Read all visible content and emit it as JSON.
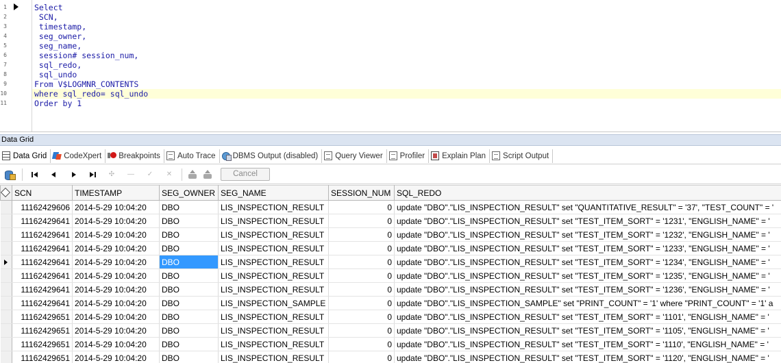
{
  "editor": {
    "line_numbers": [
      "1",
      "2",
      "3",
      "4",
      "5",
      "6",
      "7",
      "8",
      "9",
      "10",
      "11"
    ],
    "lines": [
      "Select",
      " SCN,",
      " timestamp,",
      " seg_owner,",
      " seg_name,",
      " session# session_num,",
      " sql_redo,",
      " sql_undo",
      "From V$LOGMNR_CONTENTS",
      "where sql_redo= sql_undo",
      "Order by 1"
    ],
    "highlight_line": 10
  },
  "panel": {
    "title": "Data Grid"
  },
  "tabs": [
    {
      "label": "Data Grid",
      "icon": "grid-icon",
      "active": true
    },
    {
      "label": "CodeXpert",
      "icon": "codexpert-icon"
    },
    {
      "label": "Breakpoints",
      "icon": "breakpoint-icon"
    },
    {
      "label": "Auto Trace",
      "icon": "page-icon"
    },
    {
      "label": "DBMS Output (disabled)",
      "icon": "dbms-output-icon"
    },
    {
      "label": "Query Viewer",
      "icon": "page-icon"
    },
    {
      "label": "Profiler",
      "icon": "page-icon"
    },
    {
      "label": "Explain Plan",
      "icon": "explain-plan-icon"
    },
    {
      "label": "Script Output",
      "icon": "page-icon"
    }
  ],
  "toolbar": {
    "cancel_label": "Cancel"
  },
  "grid": {
    "columns": [
      "SCN",
      "TIMESTAMP",
      "SEG_OWNER",
      "SEG_NAME",
      "SESSION_NUM",
      "SQL_REDO"
    ],
    "current_row": 4,
    "selected_cell": [
      4,
      2
    ],
    "rows": [
      [
        "11162429606",
        "2014-5-29 10:04:20",
        "DBO",
        "LIS_INSPECTION_RESULT",
        "0",
        "update \"DBO\".\"LIS_INSPECTION_RESULT\" set \"QUANTITATIVE_RESULT\" = '37', \"TEST_COUNT\" = '"
      ],
      [
        "11162429641",
        "2014-5-29 10:04:20",
        "DBO",
        "LIS_INSPECTION_RESULT",
        "0",
        "update \"DBO\".\"LIS_INSPECTION_RESULT\" set \"TEST_ITEM_SORT\" = '1231', \"ENGLISH_NAME\" = '"
      ],
      [
        "11162429641",
        "2014-5-29 10:04:20",
        "DBO",
        "LIS_INSPECTION_RESULT",
        "0",
        "update \"DBO\".\"LIS_INSPECTION_RESULT\" set \"TEST_ITEM_SORT\" = '1232', \"ENGLISH_NAME\" = '"
      ],
      [
        "11162429641",
        "2014-5-29 10:04:20",
        "DBO",
        "LIS_INSPECTION_RESULT",
        "0",
        "update \"DBO\".\"LIS_INSPECTION_RESULT\" set \"TEST_ITEM_SORT\" = '1233', \"ENGLISH_NAME\" = '"
      ],
      [
        "11162429641",
        "2014-5-29 10:04:20",
        "DBO",
        "LIS_INSPECTION_RESULT",
        "0",
        "update \"DBO\".\"LIS_INSPECTION_RESULT\" set \"TEST_ITEM_SORT\" = '1234', \"ENGLISH_NAME\" = '"
      ],
      [
        "11162429641",
        "2014-5-29 10:04:20",
        "DBO",
        "LIS_INSPECTION_RESULT",
        "0",
        "update \"DBO\".\"LIS_INSPECTION_RESULT\" set \"TEST_ITEM_SORT\" = '1235', \"ENGLISH_NAME\" = '"
      ],
      [
        "11162429641",
        "2014-5-29 10:04:20",
        "DBO",
        "LIS_INSPECTION_RESULT",
        "0",
        "update \"DBO\".\"LIS_INSPECTION_RESULT\" set \"TEST_ITEM_SORT\" = '1236', \"ENGLISH_NAME\" = '"
      ],
      [
        "11162429641",
        "2014-5-29 10:04:20",
        "DBO",
        "LIS_INSPECTION_SAMPLE",
        "0",
        "update \"DBO\".\"LIS_INSPECTION_SAMPLE\" set \"PRINT_COUNT\" = '1' where \"PRINT_COUNT\" = '1' a"
      ],
      [
        "11162429651",
        "2014-5-29 10:04:20",
        "DBO",
        "LIS_INSPECTION_RESULT",
        "0",
        "update \"DBO\".\"LIS_INSPECTION_RESULT\" set \"TEST_ITEM_SORT\" = '1101', \"ENGLISH_NAME\" = '"
      ],
      [
        "11162429651",
        "2014-5-29 10:04:20",
        "DBO",
        "LIS_INSPECTION_RESULT",
        "0",
        "update \"DBO\".\"LIS_INSPECTION_RESULT\" set \"TEST_ITEM_SORT\" = '1105', \"ENGLISH_NAME\" = '"
      ],
      [
        "11162429651",
        "2014-5-29 10:04:20",
        "DBO",
        "LIS_INSPECTION_RESULT",
        "0",
        "update \"DBO\".\"LIS_INSPECTION_RESULT\" set \"TEST_ITEM_SORT\" = '1110', \"ENGLISH_NAME\" = '"
      ],
      [
        "11162429651",
        "2014-5-29 10:04:20",
        "DBO",
        "LIS_INSPECTION_RESULT",
        "0",
        "update \"DBO\".\"LIS_INSPECTION_RESULT\" set \"TEST_ITEM_SORT\" = '1120', \"ENGLISH_NAME\" = '"
      ]
    ]
  }
}
